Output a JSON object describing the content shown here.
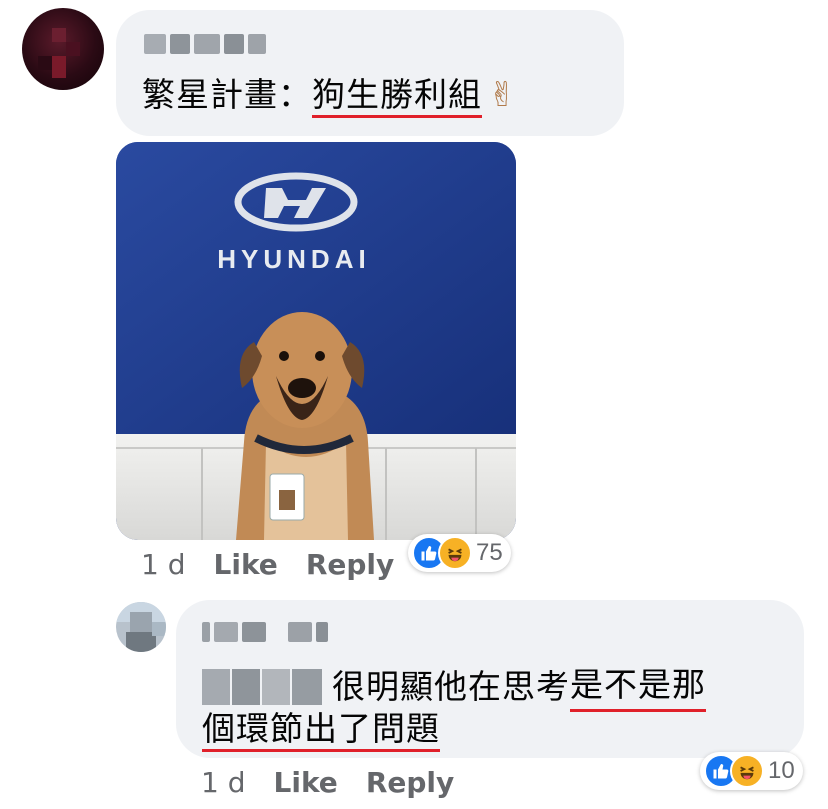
{
  "comment1": {
    "author_blurred": "■■■",
    "text_plain": "繁星計畫：",
    "text_underlined": "狗生勝利組",
    "emoji": "✌",
    "photo": {
      "brand": "HYUNDAI",
      "subject": "dog-with-employee-badge"
    },
    "time": "1 d",
    "like_label": "Like",
    "reply_label": "Reply",
    "reactions": {
      "icons": [
        "like-icon",
        "haha-icon"
      ],
      "count": "75"
    }
  },
  "reply1": {
    "author_blurred": "■■■ ■■",
    "mention_blurred": "■■■■",
    "text_line1_plain": "很明顯他在思考",
    "text_line1_underlined": "是不是那",
    "text_line2_underlined": "個環節出了問題",
    "time": "1 d",
    "like_label": "Like",
    "reply_label": "Reply",
    "reactions": {
      "icons": [
        "like-icon",
        "haha-icon"
      ],
      "count": "10"
    }
  },
  "colors": {
    "bubble": "#f0f2f5",
    "underline": "#e0202a",
    "meta": "#65676b",
    "hyundai_blue": "#1f3d8f",
    "like_blue": "#1877f2",
    "haha_yellow": "#f7b125"
  }
}
